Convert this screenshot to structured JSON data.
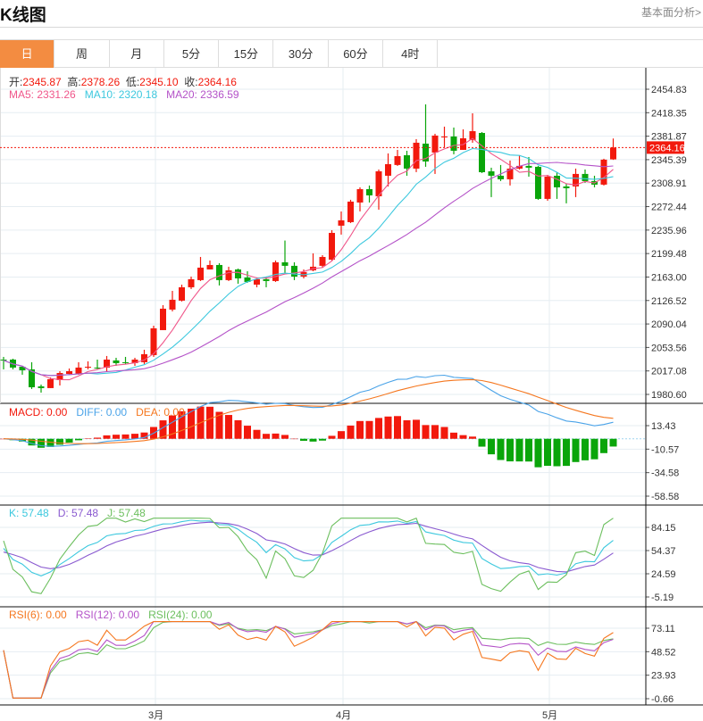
{
  "header": {
    "title": "K线图",
    "link": "基本面分析>"
  },
  "tabs": [
    {
      "label": "日",
      "active": true
    },
    {
      "label": "周"
    },
    {
      "label": "月"
    },
    {
      "label": "5分"
    },
    {
      "label": "15分"
    },
    {
      "label": "30分"
    },
    {
      "label": "60分"
    },
    {
      "label": "4时"
    }
  ],
  "ohlc_info": {
    "open_label": "开:",
    "open": "2345.87",
    "high_label": "高:",
    "high": "2378.26",
    "low_label": "低:",
    "low": "2345.10",
    "close_label": "收:",
    "close": "2364.16"
  },
  "ma_info": {
    "ma5": "MA5: 2331.26",
    "ma10": "MA10: 2320.18",
    "ma20": "MA20: 2336.59"
  },
  "macd_info": {
    "macd": "MACD: 0.00",
    "diff": "DIFF: 0.00",
    "dea": "DEA: 0.00"
  },
  "kdj_info": {
    "k": "K: 57.48",
    "d": "D: 57.48",
    "j": "J: 57.48"
  },
  "rsi_info": {
    "rsi6": "RSI(6): 0.00",
    "rsi12": "RSI(12): 0.00",
    "rsi24": "RSI(24): 0.00"
  },
  "current_price": "2364.16",
  "colors": {
    "up": "#f2190d",
    "down": "#0aa50a",
    "ma5": "#f0568a",
    "ma10": "#3cc8de",
    "ma20": "#b452c8",
    "accent": "#f38c41",
    "diff": "#4aa3e8",
    "dea": "#f5771f",
    "k": "#3cc8de",
    "d": "#8a5ad0",
    "j": "#6cbf5e",
    "rsi6": "#f5771f",
    "rsi12": "#b452c8",
    "rsi24": "#6cbf5e"
  },
  "chart_data": {
    "type": "candlestick",
    "x_labels": [
      {
        "label": "3月",
        "index": 16
      },
      {
        "label": "4月",
        "index": 36
      },
      {
        "label": "5月",
        "index": 58
      }
    ],
    "price_ticks": [
      "2454.83",
      "2418.35",
      "2381.87",
      "2345.39",
      "2308.91",
      "2272.44",
      "2235.96",
      "2199.48",
      "2163.00",
      "2126.52",
      "2090.04",
      "2053.56",
      "2017.08",
      "1980.60"
    ],
    "price_range": [
      1980.6,
      2454.83
    ],
    "macd_ticks": [
      "13.43",
      "-10.57",
      "-34.58",
      "-58.58"
    ],
    "macd_range": [
      -58.58,
      13.43
    ],
    "kdj_ticks": [
      "84.15",
      "54.37",
      "24.59",
      "-5.19"
    ],
    "kdj_range": [
      -5.19,
      84.15
    ],
    "rsi_ticks": [
      "73.11",
      "48.52",
      "23.93",
      "-0.66"
    ],
    "rsi_range": [
      -0.66,
      73.11
    ],
    "candles": [
      [
        2034.7,
        2038.9,
        2019.5,
        2033.4
      ],
      [
        2034.7,
        2036.1,
        2019.5,
        2022.3
      ],
      [
        2023.6,
        2025.0,
        2011.2,
        2018.1
      ],
      [
        2019.5,
        2030.6,
        1989.0,
        1991.7
      ],
      [
        1993.1,
        1995.9,
        1983.4,
        1990.4
      ],
      [
        1990.4,
        2007.0,
        1990.4,
        2004.2
      ],
      [
        2002.8,
        2016.7,
        1994.5,
        2013.9
      ],
      [
        2012.5,
        2020.9,
        2011.2,
        2016.7
      ],
      [
        2012.5,
        2030.6,
        2011.2,
        2022.3
      ],
      [
        2022.3,
        2032.0,
        2019.5,
        2023.6
      ],
      [
        2022.3,
        2034.7,
        2019.5,
        2020.9
      ],
      [
        2022.3,
        2040.3,
        2015.3,
        2034.7
      ],
      [
        2033.4,
        2037.5,
        2025.0,
        2029.2
      ],
      [
        2030.6,
        2038.9,
        2027.8,
        2029.2
      ],
      [
        2029.2,
        2037.5,
        2025.0,
        2034.7
      ],
      [
        2030.6,
        2050.0,
        2027.8,
        2043.1
      ],
      [
        2041.7,
        2087.4,
        2038.9,
        2083.3
      ],
      [
        2080.5,
        2119.3,
        2080.5,
        2113.8
      ],
      [
        2112.4,
        2141.5,
        2109.6,
        2127.7
      ],
      [
        2126.3,
        2151.2,
        2124.9,
        2147.1
      ],
      [
        2147.1,
        2163.7,
        2144.3,
        2159.6
      ],
      [
        2158.2,
        2194.2,
        2156.8,
        2177.6
      ],
      [
        2174.8,
        2188.7,
        2174.8,
        2181.7
      ],
      [
        2181.7,
        2184.5,
        2149.9,
        2158.2
      ],
      [
        2158.2,
        2179.0,
        2156.8,
        2173.4
      ],
      [
        2174.8,
        2176.2,
        2152.6,
        2160.9
      ],
      [
        2162.3,
        2172.0,
        2154.0,
        2155.4
      ],
      [
        2151.2,
        2162.3,
        2147.1,
        2159.6
      ],
      [
        2159.6,
        2163.7,
        2147.1,
        2156.8
      ],
      [
        2156.8,
        2188.7,
        2155.4,
        2185.9
      ],
      [
        2185.9,
        2219.7,
        2167.9,
        2180.4
      ],
      [
        2180.4,
        2185.9,
        2158.2,
        2163.7
      ],
      [
        2163.7,
        2174.8,
        2160.9,
        2170.7
      ],
      [
        2173.4,
        2199.8,
        2172.0,
        2179.0
      ],
      [
        2180.4,
        2197.0,
        2177.6,
        2194.2
      ],
      [
        2190.0,
        2235.8,
        2188.7,
        2231.6
      ],
      [
        2242.8,
        2264.9,
        2228.9,
        2251.1
      ],
      [
        2248.3,
        2283.0,
        2246.9,
        2280.2
      ],
      [
        2278.8,
        2302.4,
        2265.0,
        2299.6
      ],
      [
        2299.6,
        2305.2,
        2278.8,
        2289.9
      ],
      [
        2288.5,
        2330.1,
        2267.7,
        2327.3
      ],
      [
        2320.4,
        2355.1,
        2303.8,
        2338.4
      ],
      [
        2337.1,
        2360.6,
        2335.7,
        2350.9
      ],
      [
        2352.3,
        2359.2,
        2320.4,
        2331.5
      ],
      [
        2331.5,
        2377.3,
        2326.0,
        2371.7
      ],
      [
        2370.3,
        2431.3,
        2334.3,
        2342.6
      ],
      [
        2356.4,
        2385.6,
        2323.2,
        2382.8
      ],
      [
        2380.5,
        2396.7,
        2364.1,
        2381.4
      ],
      [
        2381.4,
        2395.3,
        2353.7,
        2359.2
      ],
      [
        2360.6,
        2392.5,
        2360.6,
        2378.6
      ],
      [
        2375.8,
        2417.4,
        2371.7,
        2389.7
      ],
      [
        2386.9,
        2388.3,
        2324.6,
        2325.9
      ],
      [
        2327.3,
        2332.9,
        2287.2,
        2320.4
      ],
      [
        2320.4,
        2337.1,
        2312.1,
        2314.9
      ],
      [
        2314.9,
        2344.0,
        2305.2,
        2331.5
      ],
      [
        2331.5,
        2352.3,
        2330.1,
        2335.7
      ],
      [
        2335.7,
        2349.5,
        2319.0,
        2332.9
      ],
      [
        2334.3,
        2335.7,
        2283.0,
        2284.4
      ],
      [
        2284.4,
        2321.8,
        2281.6,
        2319.0
      ],
      [
        2320.4,
        2326.0,
        2284.4,
        2302.4
      ],
      [
        2303.8,
        2307.9,
        2277.5,
        2301.0
      ],
      [
        2303.8,
        2331.5,
        2287.2,
        2323.2
      ],
      [
        2323.2,
        2330.1,
        2309.4,
        2312.1
      ],
      [
        2312.1,
        2320.4,
        2302.4,
        2306.6
      ],
      [
        2306.6,
        2346.8,
        2305.2,
        2345.4
      ],
      [
        2345.87,
        2378.26,
        2345.1,
        2364.16
      ]
    ]
  }
}
